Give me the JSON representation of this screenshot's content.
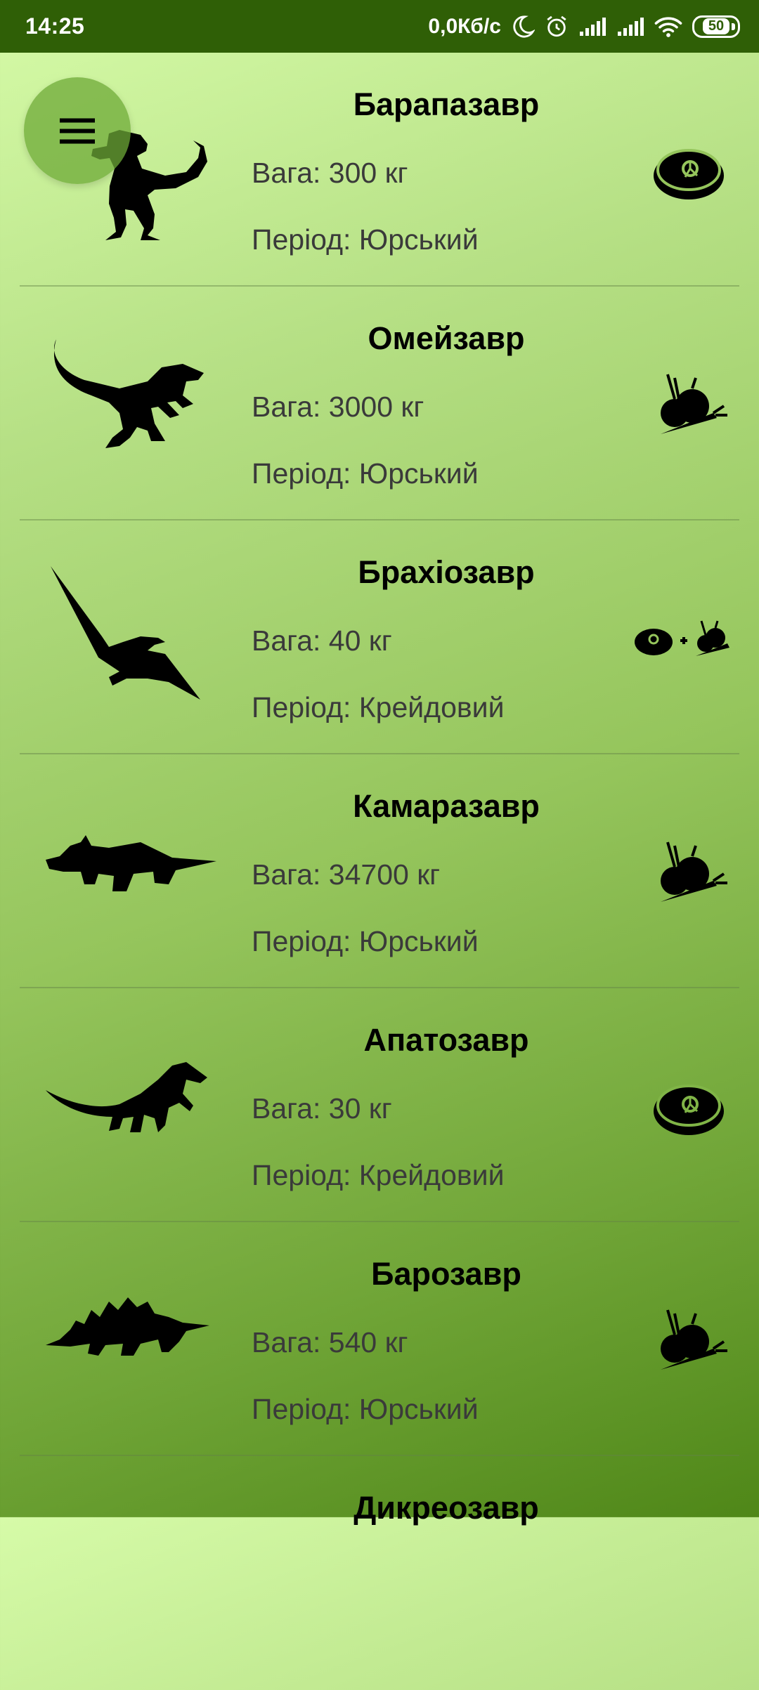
{
  "status_bar": {
    "time": "14:25",
    "net_speed": "0,0Кб/с",
    "battery": "50"
  },
  "colors": {
    "status_bar": "#2f5f06",
    "gradient_top": "#d6fba8",
    "gradient_bottom": "#4f8718",
    "fab": "#6eaa37"
  },
  "menu": {
    "icon": "hamburger-menu-icon"
  },
  "dinosaurs": [
    {
      "name": "Барапазавр",
      "weight": "Вага: 300 кг",
      "period": "Період: Юрський",
      "silhouette": "tyrannosaurus-icon",
      "diet": "meat-icon"
    },
    {
      "name": "Омейзавр",
      "weight": "Вага: 3000 кг",
      "period": "Період: Юрський",
      "silhouette": "velociraptor-icon",
      "diet": "vegetables-icon"
    },
    {
      "name": "Брахіозавр",
      "weight": "Вага: 40 кг",
      "period": "Період: Крейдовий",
      "silhouette": "pterodactyl-icon",
      "diet": "meat-plus-vegetables-icon"
    },
    {
      "name": "Камаразавр",
      "weight": "Вага: 34700 кг",
      "period": "Період: Юрський",
      "silhouette": "triceratops-icon",
      "diet": "vegetables-icon"
    },
    {
      "name": "Апатозавр",
      "weight": "Вага: 30 кг",
      "period": "Період: Крейдовий",
      "silhouette": "parasaurolophus-icon",
      "diet": "meat-icon"
    },
    {
      "name": "Барозавр",
      "weight": "Вага: 540 кг",
      "period": "Період: Юрський",
      "silhouette": "stegosaurus-icon",
      "diet": "vegetables-icon"
    },
    {
      "name": "Дикреозавр",
      "weight": "",
      "period": "",
      "silhouette": "",
      "diet": ""
    }
  ]
}
